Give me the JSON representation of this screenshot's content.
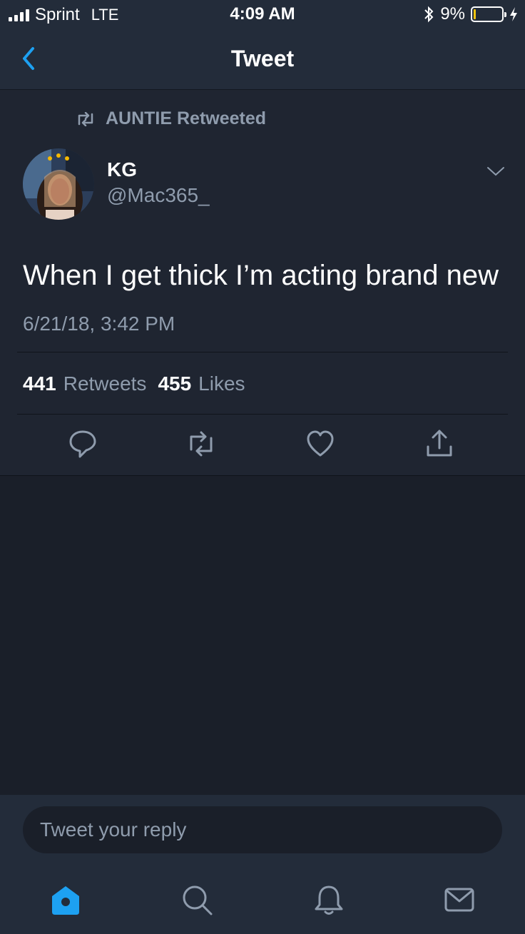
{
  "status_bar": {
    "carrier": "Sprint",
    "network": "LTE",
    "time": "4:09 AM",
    "battery_percent": "9%",
    "battery_level": 0.09
  },
  "header": {
    "title": "Tweet",
    "back_icon": "chevron-left-icon"
  },
  "tweet": {
    "retweeted_by": "AUNTIE Retweeted",
    "author_name": "KG",
    "author_handle": "@Mac365_",
    "text": "When I get thick I’m acting brand new",
    "timestamp": "6/21/18, 3:42 PM",
    "retweets_count": "441",
    "retweets_label": "Retweets",
    "likes_count": "455",
    "likes_label": "Likes",
    "actions": [
      "reply-icon",
      "retweet-icon",
      "like-icon",
      "share-icon"
    ]
  },
  "reply": {
    "placeholder": "Tweet your reply"
  },
  "tabs": [
    "home-icon",
    "search-icon",
    "notifications-icon",
    "messages-icon"
  ],
  "colors": {
    "accent": "#1da1f2",
    "background": "#1a1f29",
    "panel": "#232c3a",
    "secondary_text": "#8f9cad"
  }
}
